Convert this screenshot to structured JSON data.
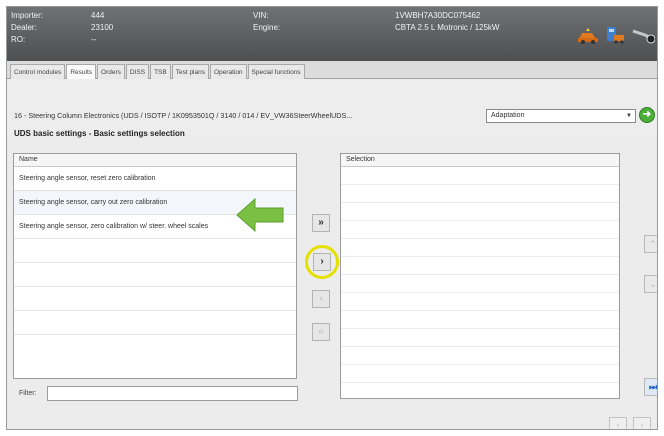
{
  "header": {
    "fields": [
      {
        "label": "Importer:",
        "value": "444"
      },
      {
        "label": "Dealer:",
        "value": "23100"
      },
      {
        "label": "RO:",
        "value": "--"
      }
    ],
    "vin_label": "VIN:",
    "vin_value": "1VWBH7A30DC075462",
    "engine_label": "Engine:",
    "engine_value": "CBTA 2.5 L Motronic / 125kW",
    "icons": [
      "car-repair-icon",
      "vehicle-info-icon",
      "diagnostics-icon"
    ]
  },
  "tabs": [
    "Control modules",
    "Results",
    "Orders",
    "DISS",
    "TSB",
    "Test plans",
    "Operation",
    "Special functions"
  ],
  "active_tab_index": 1,
  "address": {
    "path": "16 - Steering Column Electronics (UDS / ISOTP / 1K0953501Q / 3140 / 014 / EV_VW36SteerWheelUDS...",
    "mode_select": "Adaptation",
    "go_icon": "go-arrow-icon"
  },
  "subtitle": "UDS basic settings - Basic settings selection",
  "left_list": {
    "header": "Name",
    "items": [
      "Steering angle sensor, reset zero calibration",
      "Steering angle sensor, carry out zero calibration",
      "Steering angle sensor, zero calibration w/ steer. wheel scales"
    ],
    "selected_index": 1
  },
  "right_list": {
    "header": "Selection",
    "items": []
  },
  "transfer_buttons": {
    "add_all": "»",
    "add_one": "›",
    "remove_one": "‹",
    "remove_all": "«"
  },
  "filter": {
    "label": "Filter:",
    "value": ""
  },
  "scroll_buttons": {
    "up": "⌃",
    "down": "⌄",
    "end": "⏭"
  },
  "nav": {
    "back": "‹",
    "forward": "›"
  },
  "colors": {
    "header_bg": "#5b5d5f",
    "highlight_circle": "#e5e000",
    "annotation_arrow": "#7ac143",
    "go_button": "#4caf3a"
  }
}
